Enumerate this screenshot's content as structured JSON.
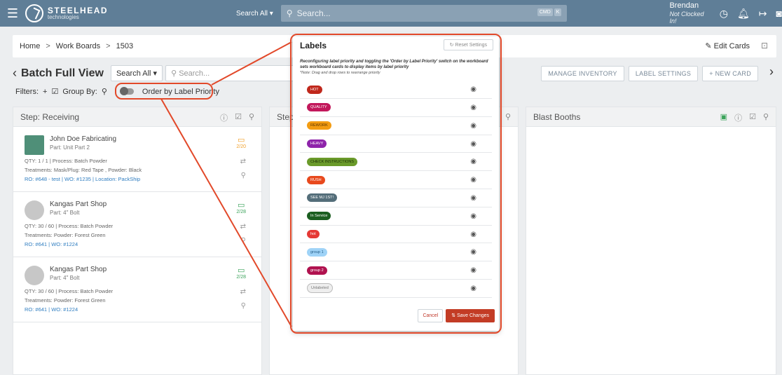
{
  "topbar": {
    "brand_title": "STEELHEAD",
    "brand_sub": "technologies",
    "search_scope": "Search All ▾",
    "search_placeholder": "Search...",
    "kbd_ctrl": "CMD",
    "kbd_k": "K",
    "user_name": "Brendan",
    "user_status": "Not Clocked In!"
  },
  "breadcrumb": {
    "home": "Home",
    "work_boards": "Work Boards",
    "current": "1503",
    "sep": ">",
    "edit_cards": "Edit Cards"
  },
  "header": {
    "title": "Batch Full View",
    "search_scope": "Search All ▾",
    "search_placeholder": "Search...",
    "filters": "Filters:",
    "group_by": "Group By:",
    "order_label": "Order by Label Priority",
    "manage_inventory": "MANAGE INVENTORY",
    "label_settings": "LABEL SETTINGS",
    "new_card": "+ NEW CARD"
  },
  "columns": {
    "receiving": "Step: Receiving",
    "middle": "Step",
    "blast": "Blast Booths"
  },
  "cards": [
    {
      "customer": "John Doe Fabricating",
      "part": "Part: Unit Part 2",
      "qty": "QTY: 1 / 1  |  Process: Batch Powder",
      "treatments": "Treatments: Mask/Plug: Red Tape , Powder: Black",
      "links": "RO: #648 - test  |  WO: #1235  |  Location: PackShip",
      "date": "2/20"
    },
    {
      "customer": "Kangas Part Shop",
      "part": "Part: 4\" Bolt",
      "qty": "QTY: 30 / 60  |  Process: Batch Powder",
      "treatments": "Treatments: Powder: Forest Green",
      "links": "RO: #641  |  WO: #1224",
      "date": "2/28"
    },
    {
      "customer": "Kangas Part Shop",
      "part": "Part: 4\" Bolt",
      "qty": "QTY: 30 / 60  |  Process: Batch Powder",
      "treatments": "Treatments: Powder: Forest Green",
      "links": "RO: #641  |  WO: #1224",
      "date": "2/28"
    }
  ],
  "modal": {
    "title": "Labels",
    "reset": "Reset Settings",
    "description": "Reconfiguring label priority and toggling the 'Order by Label Priority' switch on the workboard sets workboard cards to display items by label priority",
    "note": "*Note: Drag and drop rows to rearrange priority",
    "cancel": "Cancel",
    "save": "Save Changes",
    "labels": [
      {
        "text": "HOT",
        "color": "#c0281c",
        "fg": "#ffffff"
      },
      {
        "text": "QUALITY",
        "color": "#c2185b",
        "fg": "#ffffff"
      },
      {
        "text": "REWORK",
        "color": "#f39c12",
        "fg": "#5a3300"
      },
      {
        "text": "HEAVY",
        "color": "#8e24aa",
        "fg": "#ffffff"
      },
      {
        "text": "CHECK INSTRUCTIONS",
        "color": "#6a9a2a",
        "fg": "#1b2d05"
      },
      {
        "text": "RUSH",
        "color": "#e8491d",
        "fg": "#ffffff"
      },
      {
        "text": "SEE MJ 1ST!",
        "color": "#546e7a",
        "fg": "#ffffff"
      },
      {
        "text": "In Service",
        "color": "#1b5e20",
        "fg": "#ffffff"
      },
      {
        "text": "hot",
        "color": "#e53935",
        "fg": "#ffffff"
      },
      {
        "text": "group 1",
        "color": "#9fd3f7",
        "fg": "#255d86"
      },
      {
        "text": "group 2",
        "color": "#b0124f",
        "fg": "#ffffff"
      },
      {
        "text": "Unlabeled",
        "color": "#eeeeee",
        "fg": "#777777"
      }
    ]
  },
  "colors": {
    "topbar": "#5f7e97",
    "annotation": "#e2492a",
    "save_button": "#c33c25"
  }
}
